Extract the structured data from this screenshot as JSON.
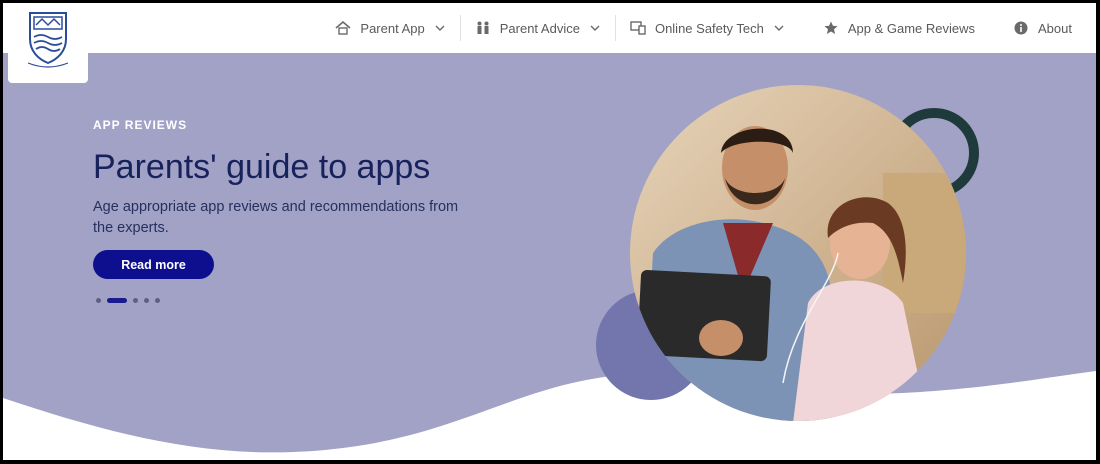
{
  "header": {
    "logo_alt": "School crest",
    "nav": [
      {
        "label": "Parent App",
        "icon": "house-icon",
        "dropdown": true
      },
      {
        "label": "Parent Advice",
        "icon": "family-icon",
        "dropdown": true
      },
      {
        "label": "Online Safety Tech",
        "icon": "devices-icon",
        "dropdown": true
      },
      {
        "label": "App & Game Reviews",
        "icon": "star-icon",
        "dropdown": false
      },
      {
        "label": "About",
        "icon": "info-icon",
        "dropdown": false
      }
    ]
  },
  "hero": {
    "eyebrow": "APP REVIEWS",
    "title": "Parents' guide to apps",
    "subtitle": "Age appropriate app reviews and recommendations from the experts.",
    "cta_label": "Read more",
    "slides_total": 5,
    "active_slide": 2
  },
  "colors": {
    "hero_bg": "#a1a2c6",
    "title": "#17215c",
    "cta": "#0e0f8f",
    "ring": "#1f3a3a",
    "purple_circle": "#7375ad"
  }
}
